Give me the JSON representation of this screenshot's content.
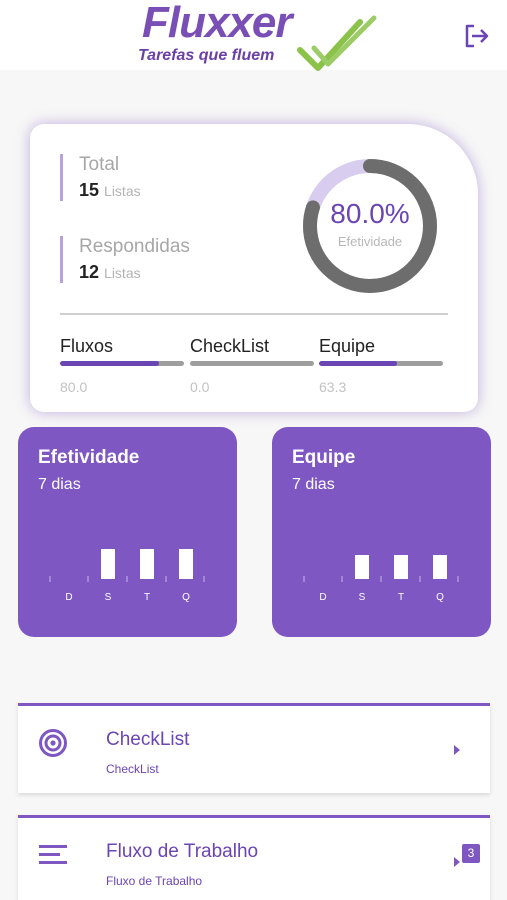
{
  "header": {
    "logo_text": "Fluxxer",
    "logo_tagline": "Tarefas que fluem",
    "logout_icon": "logout-icon"
  },
  "summary": {
    "total": {
      "title": "Total",
      "value": "15",
      "unit": "Listas"
    },
    "answered": {
      "title": "Respondidas",
      "value": "12",
      "unit": "Listas"
    },
    "gauge": {
      "value_text": "80.0%",
      "label": "Efetividade",
      "percent": 80.0
    },
    "metrics": [
      {
        "label": "Fluxos",
        "value": "80.0",
        "percent": 80.0
      },
      {
        "label": "CheckList",
        "value": "0.0",
        "percent": 0.0
      },
      {
        "label": "Equipe",
        "value": "63.3",
        "percent": 63.3
      }
    ]
  },
  "cards": [
    {
      "title": "Efetividade",
      "subtitle": "7 dias",
      "days": [
        "D",
        "S",
        "T",
        "Q"
      ]
    },
    {
      "title": "Equipe",
      "subtitle": "7 dias",
      "days": [
        "D",
        "S",
        "T",
        "Q"
      ]
    }
  ],
  "list": [
    {
      "title": "CheckList",
      "subtitle": "CheckList",
      "icon": "target-icon"
    },
    {
      "title": "Fluxo de Trabalho",
      "subtitle": "Fluxo de Trabalho",
      "icon": "menu-icon",
      "badge": "3"
    }
  ],
  "colors": {
    "primary": "#7e57c2",
    "accent": "#6a45b3",
    "logo_green": "#8bc34a"
  }
}
